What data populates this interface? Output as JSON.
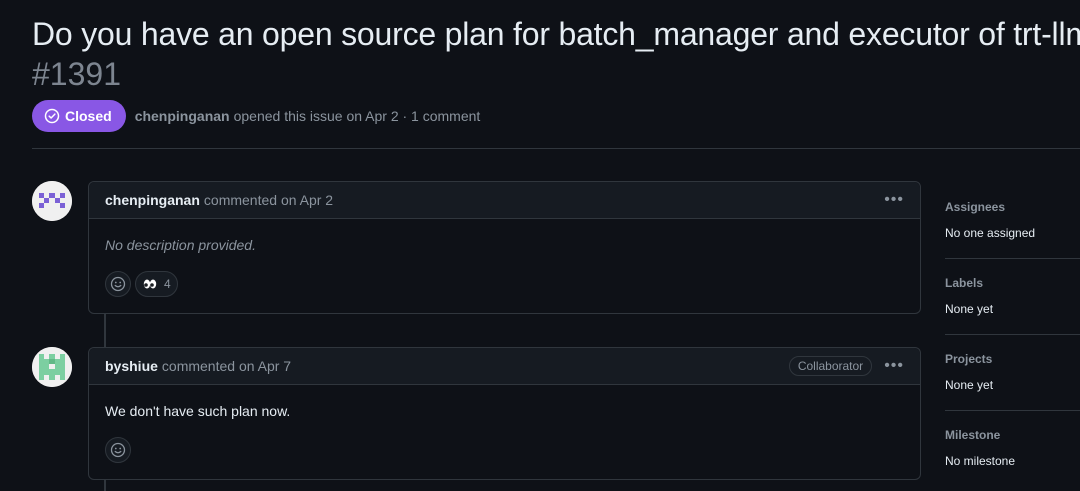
{
  "issue": {
    "title": "Do you have an open source plan for batch_manager and executor of trt-llm?",
    "number": "#1391",
    "state": "Closed",
    "state_color": "#8957e5",
    "author": "chenpinganan",
    "meta_text": "opened this issue on Apr 2 · 1 comment"
  },
  "comments": [
    {
      "author": "chenpinganan",
      "action": "commented on Apr 2",
      "body": "No description provided.",
      "avatar_icon": "identicon-purple",
      "reactions": [
        {
          "icon": "eyes-icon",
          "count": "4"
        }
      ]
    },
    {
      "author": "byshiue",
      "action": "commented on Apr 7",
      "badge": "Collaborator",
      "body": "We don't have such plan now.",
      "avatar_icon": "identicon-green"
    }
  ],
  "sidebar": {
    "sections": [
      {
        "label": "Assignees",
        "value": "No one assigned"
      },
      {
        "label": "Labels",
        "value": "None yet"
      },
      {
        "label": "Projects",
        "value": "None yet"
      },
      {
        "label": "Milestone",
        "value": "No milestone"
      }
    ]
  },
  "icons": {
    "state": "check-circle-icon",
    "more": "kebab-horizontal-icon",
    "add_reaction": "smiley-icon"
  }
}
